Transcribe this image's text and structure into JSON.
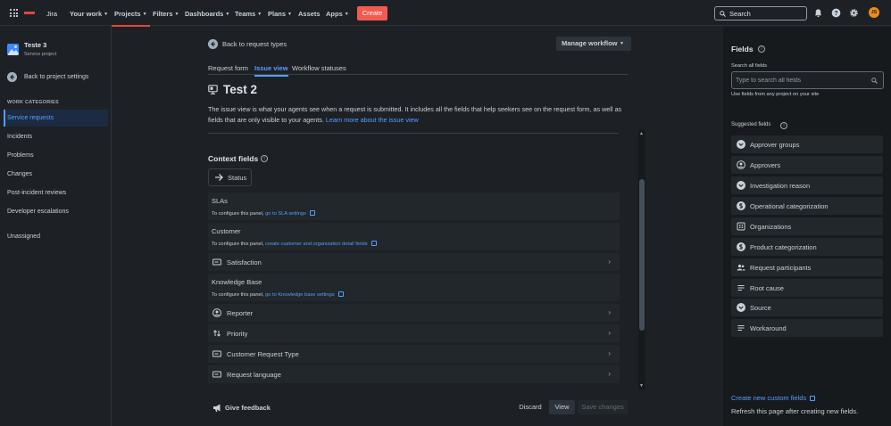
{
  "topnav": {
    "app_name": "Jira",
    "items": [
      {
        "label": "Your work"
      },
      {
        "label": "Projects"
      },
      {
        "label": "Filters"
      },
      {
        "label": "Dashboards"
      },
      {
        "label": "Teams"
      },
      {
        "label": "Plans"
      },
      {
        "label": "Assets"
      },
      {
        "label": "Apps"
      }
    ],
    "active_item": "Projects",
    "create_label": "Create",
    "search_placeholder": "Search",
    "avatar_initials": "JS",
    "brand_color": "#e2483d",
    "avatar_color": "#f18d13"
  },
  "sidebar": {
    "project_name": "Teste 3",
    "project_type": "Service project",
    "back_label": "Back to project settings",
    "section_label": "WORK CATEGORIES",
    "items": [
      {
        "label": "Service requests"
      },
      {
        "label": "Incidents"
      },
      {
        "label": "Problems"
      },
      {
        "label": "Changes"
      },
      {
        "label": "Post-incident reviews"
      },
      {
        "label": "Developer escalations"
      },
      {
        "label": "Unassigned"
      }
    ],
    "active_item": "Service requests"
  },
  "main": {
    "back_label": "Back to request types",
    "manage_workflow_label": "Manage workflow",
    "tabs": [
      {
        "label": "Request form"
      },
      {
        "label": "Issue view"
      },
      {
        "label": "Workflow statuses"
      }
    ],
    "active_tab": "Issue view",
    "title": "Test 2",
    "description": "The issue view is what your agents see when a request is submitted. It includes all the fields that help seekers see on the request form, as well as fields that are only visible to your agents.",
    "learn_more": "Learn more about the issue view",
    "context_title": "Context fields",
    "status_label": "Status",
    "context_boxes": [
      {
        "title": "SLAs",
        "prefix": "To configure this panel,",
        "link": "go to SLA settings"
      },
      {
        "title": "Customer",
        "prefix": "To configure this panel,",
        "link": "create customer and organization detail fields"
      },
      {
        "title": "Knowledge Base",
        "prefix": "To configure this panel,",
        "link": "go to Knowledge base settings"
      }
    ],
    "rows": [
      {
        "label": "Satisfaction",
        "icon": "field-icon"
      },
      {
        "label": "Reporter",
        "icon": "user-icon"
      },
      {
        "label": "Priority",
        "icon": "priority-icon"
      },
      {
        "label": "Customer Request Type",
        "icon": "field-icon"
      },
      {
        "label": "Request language",
        "icon": "field-icon"
      }
    ],
    "feedback_label": "Give feedback",
    "discard_label": "Discard",
    "view_label": "View",
    "save_label": "Save changes"
  },
  "right": {
    "title": "Fields",
    "search_label": "Search all fields",
    "search_placeholder": "Type to search all fields",
    "hint": "Use fields from any project on your site",
    "suggested_label": "Suggested fields",
    "suggested": [
      {
        "label": "Approver groups",
        "icon": "chevron-circle-icon"
      },
      {
        "label": "Approvers",
        "icon": "user-icon"
      },
      {
        "label": "Investigation reason",
        "icon": "chevron-circle-icon"
      },
      {
        "label": "Operational categorization",
        "icon": "dollar-circle-icon"
      },
      {
        "label": "Organizations",
        "icon": "building-icon"
      },
      {
        "label": "Product categorization",
        "icon": "dollar-circle-icon"
      },
      {
        "label": "Request participants",
        "icon": "people-icon"
      },
      {
        "label": "Root cause",
        "icon": "paragraph-icon"
      },
      {
        "label": "Source",
        "icon": "chevron-circle-icon"
      },
      {
        "label": "Workaround",
        "icon": "paragraph-icon"
      }
    ],
    "create_custom": "Create new custom fields",
    "refresh_note": "Refresh this page after creating new fields."
  }
}
